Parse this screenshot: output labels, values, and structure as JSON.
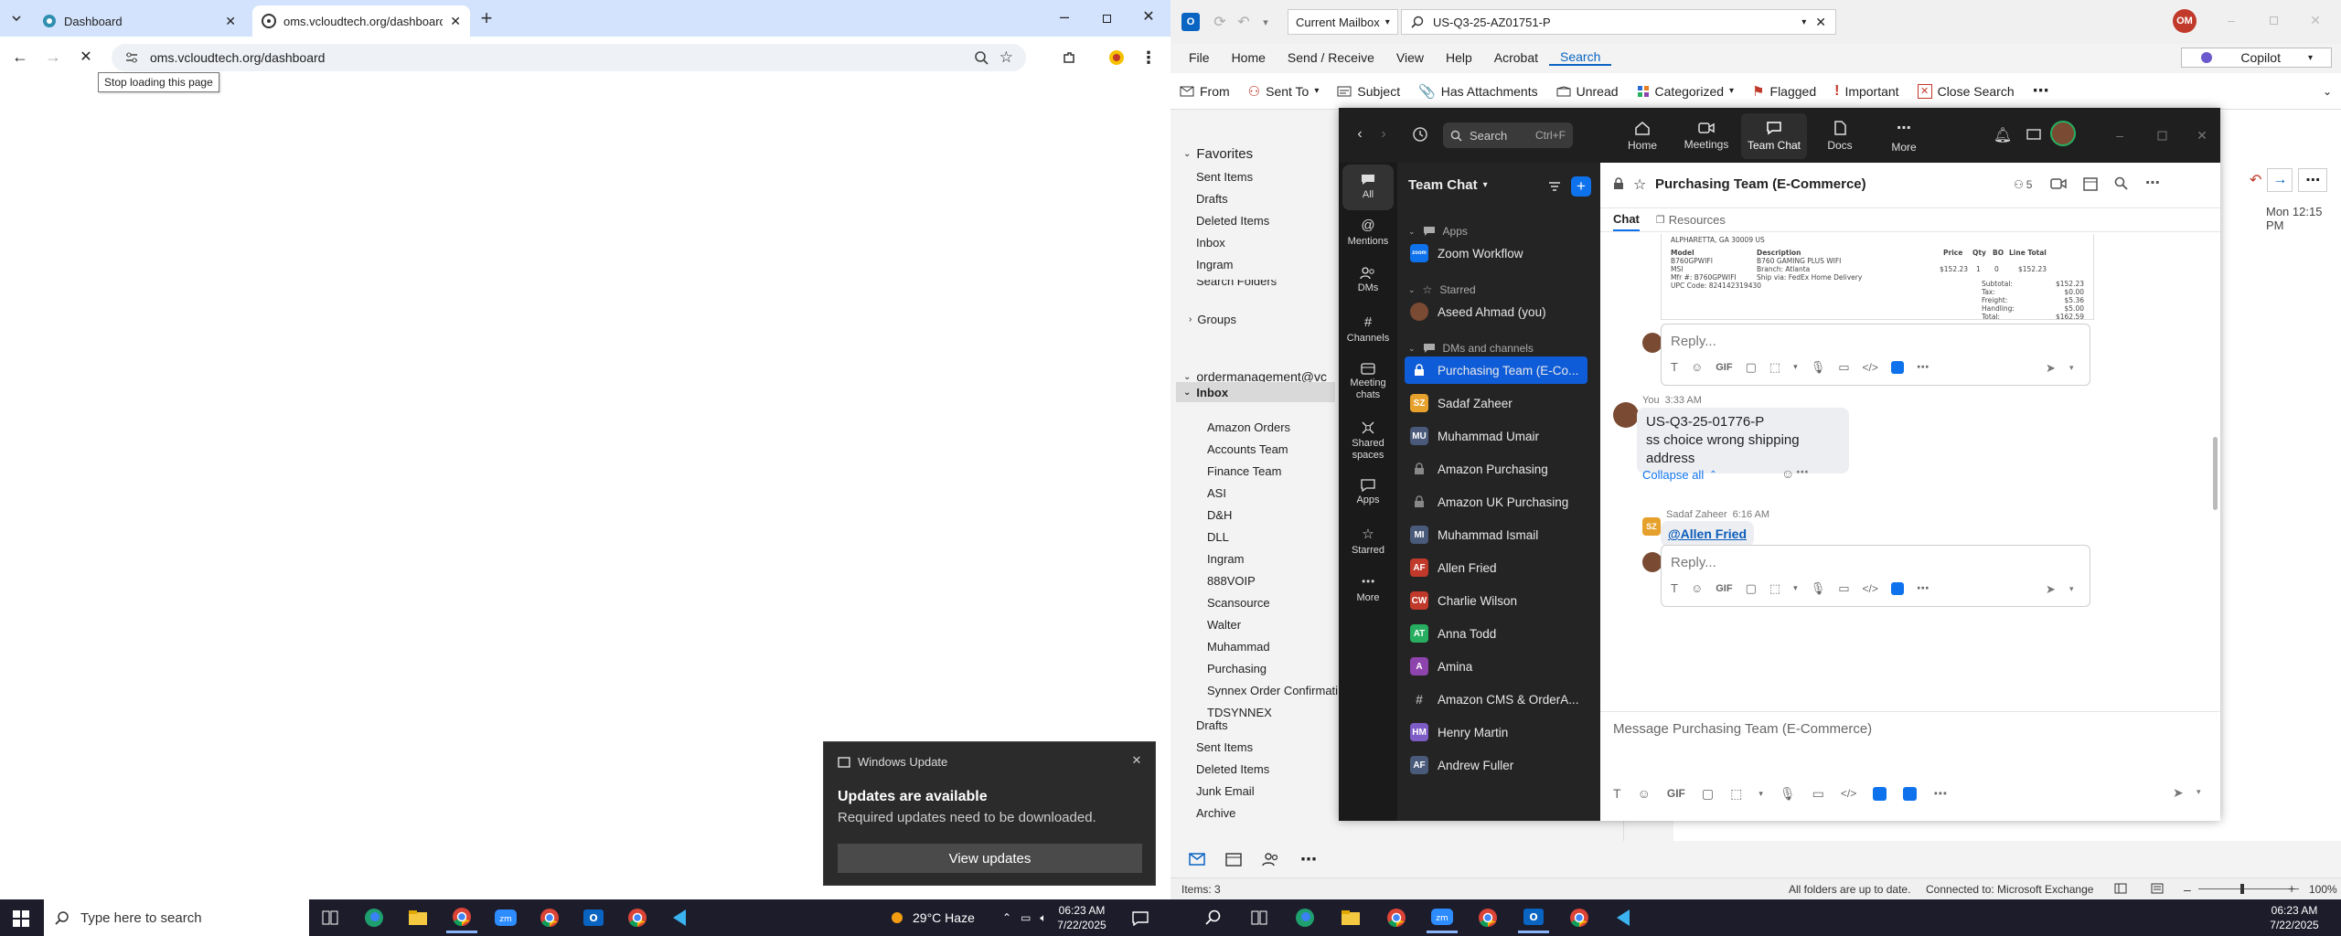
{
  "chrome": {
    "tabs": [
      {
        "label": "Dashboard",
        "active": false
      },
      {
        "label": "oms.vcloudtech.org/dashboard",
        "active": true
      }
    ],
    "url": "oms.vcloudtech.org/dashboard",
    "tooltip": "Stop loading this page"
  },
  "toast": {
    "app": "Windows Update",
    "title": "Updates are available",
    "body": "Required updates need to be downloaded.",
    "button": "View updates"
  },
  "outlook": {
    "mailbox_scope": "Current Mailbox",
    "search_query": "US-Q3-25-AZ01751-P",
    "copilot": "Copilot",
    "avatar": "OM",
    "menu": [
      "File",
      "Home",
      "Send / Receive",
      "View",
      "Help",
      "Acrobat",
      "Search"
    ],
    "ribbon": {
      "from": "From",
      "sent_to": "Sent To",
      "subject": "Subject",
      "has_attachments": "Has Attachments",
      "unread": "Unread",
      "categorized": "Categorized",
      "flagged": "Flagged",
      "important": "Important",
      "close_search": "Close Search"
    },
    "favorites_header": "Favorites",
    "favorites": [
      "Sent Items",
      "Drafts",
      "Deleted Items",
      "Inbox",
      "Ingram"
    ],
    "search_folders": "Search Folders",
    "groups": "Groups",
    "account": "ordermanagement@vc",
    "inbox": "Inbox",
    "inbox_subfolders": [
      "Amazon Orders",
      "Accounts Team",
      "Finance Team",
      "ASI",
      "D&H",
      "DLL",
      "Ingram",
      "888VOIP",
      "Scansource",
      "Walter",
      "Muhammad",
      "Purchasing",
      "Synnex Order Confirmati...",
      "TDSYNNEX"
    ],
    "other_folders": [
      "Drafts",
      "Sent Items",
      "Deleted Items",
      "Junk Email",
      "Archive"
    ],
    "mail_date": "Mon 12:15 PM",
    "status": {
      "items": "Items: 3",
      "sync": "All folders are up to date.",
      "connection": "Connected to: Microsoft Exchange",
      "zoom": "100%"
    }
  },
  "zoom": {
    "search_label": "Search",
    "search_shortcut": "Ctrl+F",
    "top_tabs": [
      "Home",
      "Meetings",
      "Team Chat",
      "Docs",
      "More"
    ],
    "rail": [
      "All",
      "Mentions",
      "DMs",
      "Channels",
      "Meeting chats",
      "Shared spaces",
      "Apps",
      "Starred",
      "More"
    ],
    "list_title": "Team Chat",
    "sections": {
      "apps": "Apps",
      "starred": "Starred",
      "dms": "DMs and channels"
    },
    "app_items": [
      "Zoom Workflow"
    ],
    "starred_items": [
      "Aseed Ahmad (you)"
    ],
    "dm_items": [
      {
        "name": "Purchasing Team (E-Co...",
        "av": "",
        "color": "#0e5cd8",
        "kind": "lock"
      },
      {
        "name": "Sadaf Zaheer",
        "av": "SZ",
        "color": "#e6a02c",
        "kind": "av"
      },
      {
        "name": "Muhammad Umair",
        "av": "MU",
        "color": "#4a5a7a",
        "kind": "av"
      },
      {
        "name": "Amazon Purchasing",
        "av": "",
        "color": "#555",
        "kind": "lock"
      },
      {
        "name": "Amazon UK Purchasing",
        "av": "",
        "color": "#555",
        "kind": "lock"
      },
      {
        "name": "Muhammad Ismail",
        "av": "MI",
        "color": "#4a5a7a",
        "kind": "av"
      },
      {
        "name": "Allen Fried",
        "av": "AF",
        "color": "#c0392b",
        "kind": "av"
      },
      {
        "name": "Charlie Wilson",
        "av": "CW",
        "color": "#c0392b",
        "kind": "av"
      },
      {
        "name": "Anna Todd",
        "av": "AT",
        "color": "#27ae60",
        "kind": "av"
      },
      {
        "name": "Amina",
        "av": "A",
        "color": "#8e44ad",
        "kind": "av"
      },
      {
        "name": "Amazon CMS & OrderA...",
        "av": "#",
        "color": "#555",
        "kind": "hash"
      },
      {
        "name": "Henry Martin",
        "av": "HM",
        "color": "#7d5cc6",
        "kind": "av"
      },
      {
        "name": "Andrew Fuller",
        "av": "AF",
        "color": "#4a5a7a",
        "kind": "av"
      }
    ],
    "channel": {
      "name": "Purchasing Team (E-Commerce)",
      "members": "5",
      "tabs": [
        "Chat",
        "Resources"
      ]
    },
    "invoice": {
      "address": "ALPHARETTA, GA 30009 US",
      "col_model": "Model",
      "col_desc": "Description",
      "col_price": "Price",
      "col_qty": "Qty",
      "col_bo": "BO",
      "col_total": "Line Total",
      "model_lines": [
        "B760GPWIFI",
        "MSI",
        "Mfr #: B760GPWIFI",
        "UPC Code: 824142319430"
      ],
      "desc_lines": [
        "B760 GAMING PLUS WIFI",
        "Branch: Atlanta",
        "Ship via: FedEx Home Delivery"
      ],
      "price": "$152.23",
      "qty": "1",
      "bo": "0",
      "line_total": "$152.23",
      "summary": [
        {
          "k": "Subtotal:",
          "v": "$152.23"
        },
        {
          "k": "Tax:",
          "v": "$0.00"
        },
        {
          "k": "Freight:",
          "v": "$5.36"
        },
        {
          "k": "Handling:",
          "v": "$5.00"
        },
        {
          "k": "Total:",
          "v": "$162.59"
        }
      ]
    },
    "reply_placeholder": "Reply...",
    "message": {
      "sender": "You",
      "time": "3:33 AM",
      "line1": "US-Q3-25-01776-P",
      "line2": "ss choice wrong shipping address"
    },
    "collapse": "Collapse all",
    "thread_reply": {
      "sender": "Sadaf Zaheer",
      "time": "6:16 AM",
      "avatar": "SZ",
      "mention": "@Allen Fried"
    },
    "compose_placeholder": "Message Purchasing Team (E-Commerce)",
    "gif": "GIF"
  },
  "taskbar": {
    "search_placeholder": "Type here to search",
    "weather": "29°C  Haze",
    "time": "06:23 AM",
    "date": "7/22/2025"
  }
}
